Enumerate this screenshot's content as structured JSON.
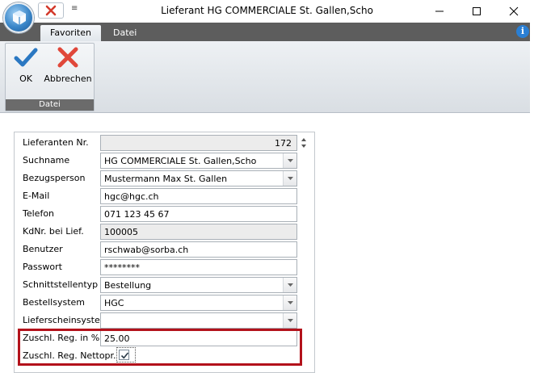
{
  "window": {
    "title": "Lieferant HG COMMERCIALE St. Gallen,Scho",
    "qat_more": "≡",
    "icons": [
      "app-orb-icon",
      "close-x-icon",
      "minimize-icon",
      "maximize-icon",
      "window-close-icon",
      "info-icon"
    ]
  },
  "ribbon": {
    "tabs": [
      {
        "label": "Favoriten",
        "active": true
      },
      {
        "label": "Datei",
        "active": false
      }
    ],
    "info_label": "i",
    "group": {
      "label": "Datei",
      "buttons": [
        {
          "label": "OK",
          "icon": "checkmark-icon",
          "color": "#2b78c2"
        },
        {
          "label": "Abbrechen",
          "icon": "cross-icon",
          "color": "#e0473a"
        }
      ]
    }
  },
  "form": {
    "fields": [
      {
        "label": "Lieferanten Nr.",
        "value": "172",
        "type": "spinner"
      },
      {
        "label": "Suchname",
        "value": "HG COMMERCIALE St. Gallen,Scho",
        "type": "combo"
      },
      {
        "label": "Bezugsperson",
        "value": "Mustermann Max St. Gallen",
        "type": "combo"
      },
      {
        "label": "E-Mail",
        "value": "hgc@hgc.ch",
        "type": "text"
      },
      {
        "label": "Telefon",
        "value": "071 123 45 67",
        "type": "text"
      },
      {
        "label": "KdNr. bei Lief.",
        "value": "100005",
        "type": "readonly"
      },
      {
        "label": "Benutzer",
        "value": "rschwab@sorba.ch",
        "type": "text"
      },
      {
        "label": "Passwort",
        "value": "********",
        "type": "text"
      },
      {
        "label": "Schnittstellentyp",
        "value": "Bestellung",
        "type": "combo"
      },
      {
        "label": "Bestellsystem",
        "value": "HGC",
        "type": "combo"
      },
      {
        "label": "Lieferscheinsystem",
        "value": "",
        "type": "combo"
      },
      {
        "label": "Zuschl. Reg. in %",
        "value": "25.00",
        "type": "text"
      },
      {
        "label": "Zuschl. Reg. Nettopr.",
        "value": "",
        "type": "checkbox",
        "checked": true
      }
    ],
    "highlight_color": "#b3121b"
  }
}
